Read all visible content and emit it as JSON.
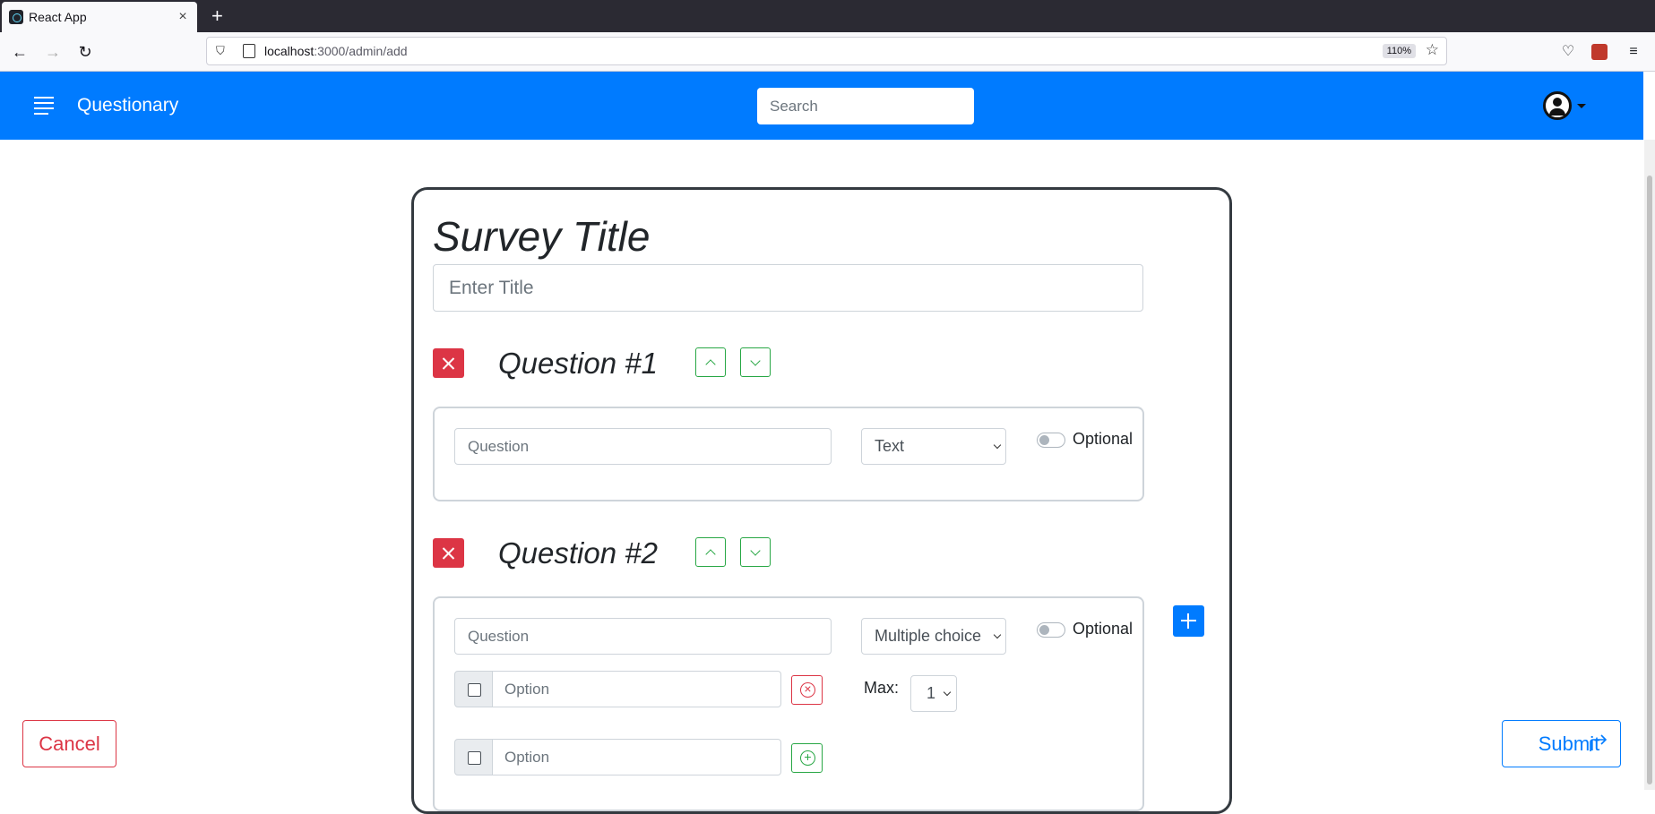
{
  "browser": {
    "tab_title": "React App",
    "tab_close": "×",
    "new_tab": "+",
    "url_host": "localhost",
    "url_path": ":3000/admin/add",
    "zoom": "110%"
  },
  "header": {
    "brand": "Questionary",
    "search_placeholder": "Search"
  },
  "form": {
    "survey_title": "Survey Title",
    "title_placeholder": "Enter Title",
    "questions": [
      {
        "title": "Question #1",
        "question_placeholder": "Question",
        "type": "Text",
        "optional_label": "Optional"
      },
      {
        "title": "Question #2",
        "question_placeholder": "Question",
        "type": "Multiple choice",
        "optional_label": "Optional",
        "option_placeholder": "Option",
        "max_label": "Max:",
        "max_value": "1"
      }
    ]
  },
  "actions": {
    "cancel": "Cancel",
    "submit": "Submit"
  },
  "colors": {
    "primary": "#007bff",
    "danger": "#dc3545",
    "success": "#28a745"
  }
}
